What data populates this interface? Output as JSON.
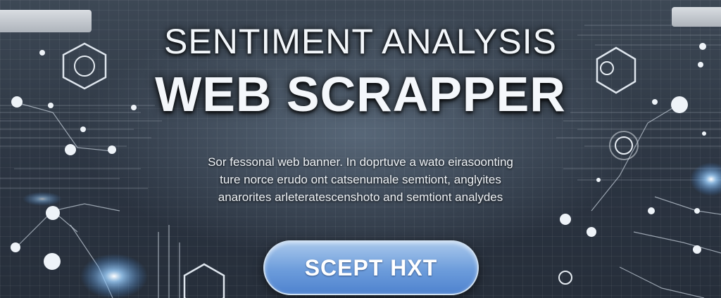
{
  "banner": {
    "title_line1": "SENTIMENT ANALYSIS",
    "title_line2": "WEB SCRAPPER",
    "description_lines": [
      "Sor fessonal web banner. In doprtuve a wato eirasoonting",
      "ture norce erudo ont catsenumale semtiont, anglyites",
      "anarorites arleteratescenshoto and semtiont analydes"
    ],
    "cta_label": "SCEPT HXT"
  },
  "colors": {
    "background": "#2b3441",
    "title": "#f4f7fb",
    "button_top": "#a9c8ec",
    "button_bottom": "#4f83cf",
    "glow": "#7fc0ff"
  },
  "icons": [
    "hexagon-node-icon",
    "circle-node-icon",
    "circuit-line-icon",
    "light-flare-icon"
  ]
}
